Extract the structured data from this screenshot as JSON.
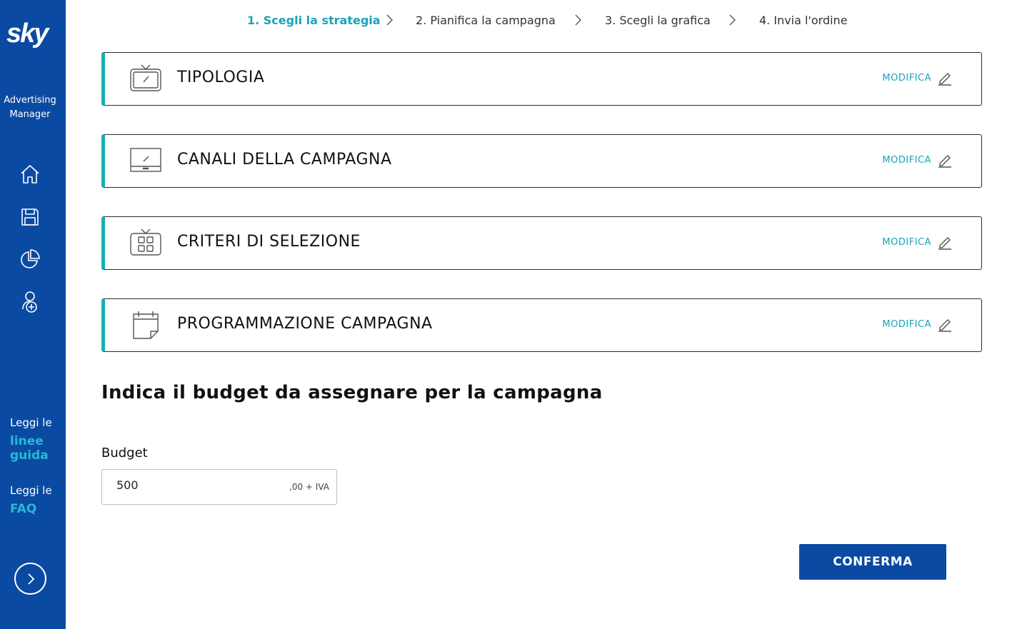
{
  "sidebar": {
    "logo": "sky",
    "brand_line1": "Advertising",
    "brand_line2": "Manager",
    "nav_icons": [
      "home-icon",
      "save-icon",
      "pie-chart-icon",
      "user-add-icon"
    ],
    "guide_prefix": "Leggi le",
    "guide_link_line1": "linee",
    "guide_link_line2": "guida",
    "faq_prefix": "Leggi le",
    "faq_link": "FAQ",
    "expand_icon": "chevron-right-icon"
  },
  "steps": [
    {
      "label": "1. Scegli la strategia",
      "active": true
    },
    {
      "label": "2. Pianifica la campagna",
      "active": false
    },
    {
      "label": "3. Scegli la grafica",
      "active": false
    },
    {
      "label": "4. Invia l'ordine",
      "active": false
    }
  ],
  "sections": [
    {
      "title": "TIPOLOGIA",
      "edit_label": "MODIFICA",
      "icon": "tv-icon"
    },
    {
      "title": "CANALI DELLA CAMPAGNA",
      "edit_label": "MODIFICA",
      "icon": "monitor-icon"
    },
    {
      "title": "CRITERI DI SELEZIONE",
      "edit_label": "MODIFICA",
      "icon": "tv-grid-icon"
    },
    {
      "title": "PROGRAMMAZIONE CAMPAGNA",
      "edit_label": "MODIFICA",
      "icon": "calendar-icon"
    }
  ],
  "budget": {
    "heading": "Indica il budget da assegnare per la campagna",
    "label": "Budget",
    "value": "500",
    "suffix": ",00 + IVA"
  },
  "confirm_label": "CONFERMA",
  "colors": {
    "sidebar": "#0b4aa2",
    "accent": "#1aa3b8",
    "card_border_accent": "#16b0b8",
    "button": "#0b4aa2"
  }
}
